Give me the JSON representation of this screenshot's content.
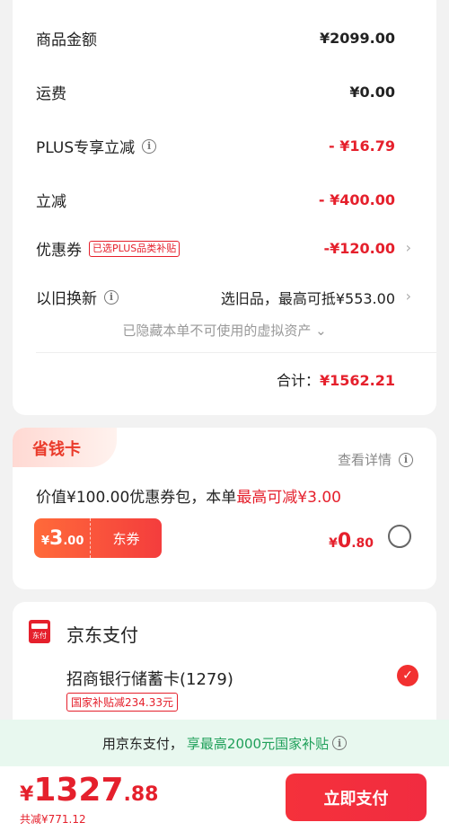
{
  "summary": {
    "rows": [
      {
        "label": "商品金额",
        "value": "¥2099.00"
      },
      {
        "label": "运费",
        "value": "¥0.00"
      },
      {
        "label": "PLUS专享立减",
        "value": "- ¥16.79"
      },
      {
        "label": "立减",
        "value": "- ¥400.00"
      },
      {
        "label": "优惠券",
        "tag": "已选PLUS品类补贴",
        "value": "-¥120.00"
      },
      {
        "label": "以旧换新",
        "value": "选旧品，最高可抵¥553.00"
      }
    ],
    "hidden_note": "已隐藏本单不可使用的虚拟资产",
    "total_label": "合计：",
    "total_value": "¥1562.21"
  },
  "save_card": {
    "title": "省钱卡",
    "detail_link": "查看详情",
    "desc_prefix": "价值¥100.00优惠券包，本单",
    "desc_highlight": "最高可减¥3.00",
    "coupon_symbol": "¥",
    "coupon_int": "3",
    "coupon_dec": ".00",
    "coupon_label": "东券",
    "price_symbol": "¥",
    "price_int": "0",
    "price_dec": ".80"
  },
  "payment": {
    "icon_text": "东付",
    "title": "京东支付",
    "bank": "招商银行储蓄卡(1279)",
    "subsidy_tag": "国家补贴减234.33元"
  },
  "green_bar": {
    "text_prefix": "用京东支付，",
    "text_green": "享最高2000元国家补贴"
  },
  "bottom": {
    "symbol": "¥",
    "price_int": "1327",
    "price_dec": ".88",
    "saved": "共减¥771.12",
    "pay_button": "立即支付"
  },
  "colors": {
    "accent_red": "#e5202c",
    "green": "#1fa05a"
  }
}
